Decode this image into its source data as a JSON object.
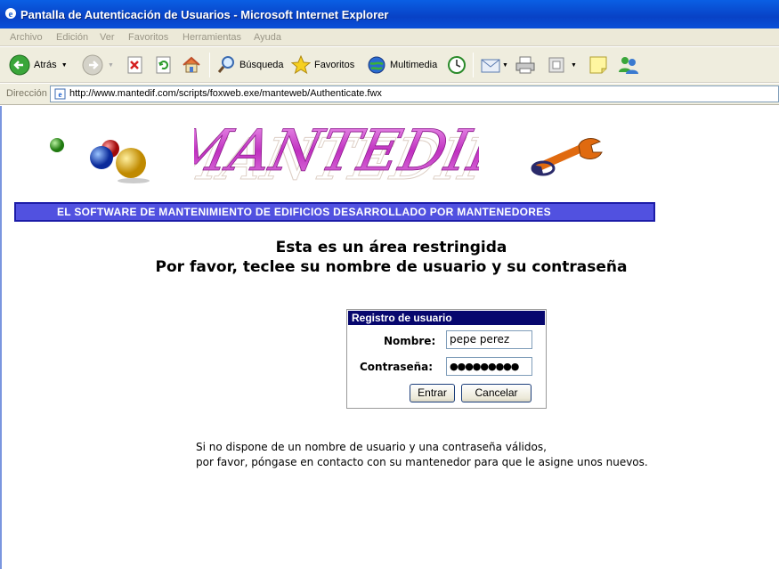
{
  "window": {
    "title": "Pantalla de Autenticación de Usuarios - Microsoft Internet Explorer"
  },
  "menu": [
    "Archivo",
    "Edición",
    "Ver",
    "Favoritos",
    "Herramientas",
    "Ayuda"
  ],
  "toolbar": {
    "back_label": "Atrás",
    "search_label": "Búsqueda",
    "favorites_label": "Favoritos",
    "multimedia_label": "Multimedia"
  },
  "address": {
    "label": "Dirección",
    "url": "http://www.mantedif.com/scripts/foxweb.exe/manteweb/Authenticate.fwx"
  },
  "page": {
    "logo_text": "MANTEDIF",
    "banner": "EL SOFTWARE DE MANTENIMIENTO DE EDIFICIOS DESARROLLADO POR MANTENEDORES",
    "heading_line1": "Esta es un área restringida",
    "heading_line2": "Por favor, teclee su nombre de usuario y su contraseña",
    "login": {
      "title": "Registro de usuario",
      "name_label": "Nombre:",
      "name_value": "pepe perez",
      "password_label": "Contraseña:",
      "password_value": "●●●●●●●●●",
      "submit_label": "Entrar",
      "cancel_label": "Cancelar"
    },
    "note_line1": "Si no dispone de un nombre de usuario y una contraseña válidos,",
    "note_line2": "por favor, póngase en contacto con su mantenedor para que le asigne unos nuevos."
  },
  "colors": {
    "titlebar": "#0842c6",
    "banner_bg": "#5151e0",
    "login_header": "#07076e",
    "logo_pink": "#c040c0"
  }
}
